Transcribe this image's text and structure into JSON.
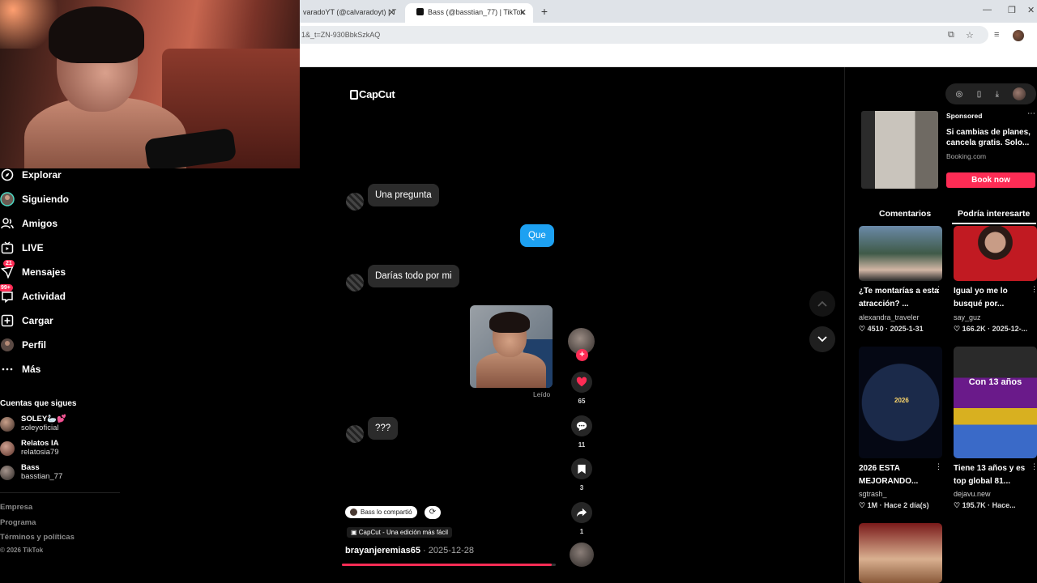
{
  "browser": {
    "tabs": [
      {
        "title": "varadoYT (@calvaradoyt) | T"
      },
      {
        "title": "Bass (@basstian_77) | TikTok"
      }
    ],
    "url": "1&_t=ZN-930BbkSzkAQ"
  },
  "sidebar": {
    "items": [
      {
        "label": "Explorar",
        "icon": "compass-icon"
      },
      {
        "label": "Siguiendo",
        "icon": "following-avatar-icon"
      },
      {
        "label": "Amigos",
        "icon": "friends-icon"
      },
      {
        "label": "LIVE",
        "icon": "live-icon"
      },
      {
        "label": "Mensajes",
        "icon": "messages-icon",
        "badge": "21"
      },
      {
        "label": "Actividad",
        "icon": "activity-icon",
        "badge": "99+"
      },
      {
        "label": "Cargar",
        "icon": "upload-icon"
      },
      {
        "label": "Perfil",
        "icon": "profile-avatar-icon"
      },
      {
        "label": "Más",
        "icon": "more-icon"
      }
    ],
    "following_title": "Cuentas que sigues",
    "following": [
      {
        "name": "SOLEY🦢💕",
        "handle": "soleyoficial"
      },
      {
        "name": "Relatos IA",
        "handle": "relatosia79"
      },
      {
        "name": "Bass",
        "handle": "basstian_77"
      }
    ],
    "footer": [
      "Empresa",
      "Programa",
      "Términos y políticas"
    ],
    "copyright": "© 2026 TikTok"
  },
  "video": {
    "watermark": "CapCut",
    "messages": [
      {
        "side": "in",
        "text": "Una pregunta"
      },
      {
        "side": "out",
        "text": "Que"
      },
      {
        "side": "in",
        "text": "Darías todo por mi"
      },
      {
        "side": "out-photo",
        "text": ""
      },
      {
        "side": "in",
        "text": "???"
      }
    ],
    "read_label": "Leído",
    "shared_chip": "Bass lo compartió",
    "capcut_line": "CapCut - Una edición más fácil",
    "author": "brayanjeremias65",
    "date": " · 2025-12-28",
    "progress": 0.98,
    "likes": "65",
    "comments": "11",
    "saves": "3",
    "shares": "1",
    "accent": "#fe2c55",
    "bubble_out_color": "#1da1f2"
  },
  "right": {
    "ad": {
      "label": "Sponsored",
      "title": "Si cambias de planes, cancela gratis. Solo...",
      "domain": "Booking.com",
      "cta": "Book now"
    },
    "tabs": [
      "Comentarios",
      "Podría interesarte"
    ],
    "cards": [
      {
        "title": "¿Te montarías a esta atracción? ...",
        "user": "alexandra_traveler",
        "likes": "4510",
        "date": "2025-1-31"
      },
      {
        "title": "Igual yo me lo busqué por...",
        "user": "say_guz",
        "likes": "166.2K",
        "date": "2025-12-..."
      },
      {
        "title": "2026 ESTA MEJORANDO...",
        "user": "sgtrash_",
        "likes": "1M",
        "date": "Hace 2 día(s)",
        "overlay": "2026"
      },
      {
        "title": "Tiene 13 años y es top global 81...",
        "user": "dejavu.new",
        "likes": "195.7K",
        "date": "Hace...",
        "overlay": "Con 13 años"
      }
    ]
  }
}
